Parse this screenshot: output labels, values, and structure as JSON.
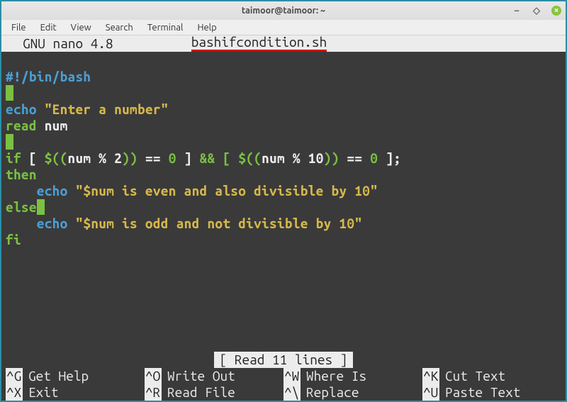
{
  "window": {
    "title": "taimoor@taimoor: ~"
  },
  "menu": {
    "file": "File",
    "edit": "Edit",
    "view": "View",
    "search": "Search",
    "terminal": "Terminal",
    "help": "Help"
  },
  "nano": {
    "header_title": "GNU nano 4.8",
    "filename": "bashifcondition.sh",
    "status": "[ Read 11 lines ]"
  },
  "code": {
    "l1": "#!/bin/bash",
    "l3_cmd": "echo",
    "l3_str": "\"Enter a number\"",
    "l4_cmd": "read",
    "l4_arg": " num",
    "l6_if": "if",
    "l6_a": " [ ",
    "l6_b": "$((",
    "l6_c": "num % 2",
    "l6_d": "))",
    "l6_e": " == ",
    "l6_f": "0",
    "l6_g": " ] ",
    "l6_h": "&& [ ",
    "l6_i": "$((",
    "l6_j": "num % 10",
    "l6_k": "))",
    "l6_l": " == ",
    "l6_m": "0",
    "l6_n": " ];",
    "l7": "then",
    "l8_indent": "    ",
    "l8_cmd": "echo",
    "l8_str": " \"$num is even and also divisible by 10\"",
    "l9": "else",
    "l10_indent": "    ",
    "l10_cmd": "echo",
    "l10_str": " \"$num is odd and not divisible by 10\"",
    "l11": "fi"
  },
  "shortcuts": {
    "r1": [
      {
        "key": "^G",
        "label": "Get Help"
      },
      {
        "key": "^O",
        "label": "Write Out"
      },
      {
        "key": "^W",
        "label": "Where Is"
      },
      {
        "key": "^K",
        "label": "Cut Text"
      }
    ],
    "r2": [
      {
        "key": "^X",
        "label": "Exit"
      },
      {
        "key": "^R",
        "label": "Read File"
      },
      {
        "key": "^\\",
        "label": "Replace"
      },
      {
        "key": "^U",
        "label": "Paste Text"
      }
    ]
  }
}
